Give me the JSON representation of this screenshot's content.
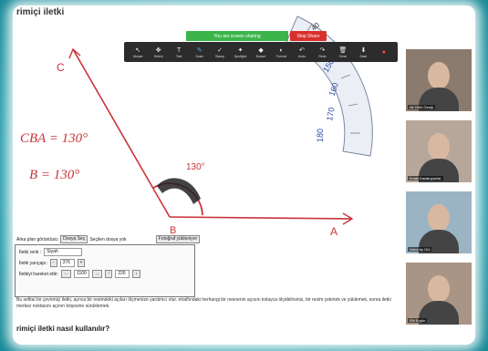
{
  "page": {
    "tab_title": "rimiçi iletki"
  },
  "whiteboard": {
    "label_c": "C",
    "label_b": "B",
    "label_a": "A",
    "eq1": "CBA = 130°",
    "eq2": "B = 130°",
    "angle_label": "130°",
    "protractor_ticks": [
      "180",
      "170",
      "160",
      "150",
      "140",
      "130",
      "50",
      "40"
    ]
  },
  "zoom": {
    "share_banner": "You are screen sharing",
    "stop_share": "Stop Share",
    "tools": [
      {
        "icon": "mouse-icon",
        "glyph": "↖",
        "label": "Mouse"
      },
      {
        "icon": "select-icon",
        "glyph": "✥",
        "label": "Select"
      },
      {
        "icon": "text-icon",
        "glyph": "T",
        "label": "Text"
      },
      {
        "icon": "draw-icon",
        "glyph": "✎",
        "label": "Draw"
      },
      {
        "icon": "stamp-icon",
        "glyph": "✓",
        "label": "Stamp"
      },
      {
        "icon": "spotlight-icon",
        "glyph": "✦",
        "label": "Spotlight"
      },
      {
        "icon": "eraser-icon",
        "glyph": "◆",
        "label": "Eraser"
      },
      {
        "icon": "format-icon",
        "glyph": "◐",
        "label": "Format"
      },
      {
        "icon": "undo-icon",
        "glyph": "↶",
        "label": "Undo"
      },
      {
        "icon": "redo-icon",
        "glyph": "↷",
        "label": "Redo"
      },
      {
        "icon": "clear-icon",
        "glyph": "🗑",
        "label": "Clear"
      },
      {
        "icon": "save-icon",
        "glyph": "⬇",
        "label": "Save"
      }
    ],
    "active_tool": 3
  },
  "participants": [
    {
      "name": "Ali Zülfü Özalp",
      "color": "#8a7b6e"
    },
    {
      "name": "Irmak Karakoyunlar",
      "color": "#b7a79b"
    },
    {
      "name": "Umut Ay Gül",
      "color": "#9ab4c4"
    },
    {
      "name": "Elif Ergün",
      "color": "#a99585"
    }
  ],
  "controls": {
    "bg_label": "Arka plan görüntüsü:",
    "file_button": "Dosya Seç",
    "file_status": "Seçilen dosya yok",
    "freeze_button": "Fotoğraf yükleniyor",
    "color_label": "İletki renk :",
    "color_value": "Siyah",
    "radius_label": "İletki yarıçapı:",
    "radius_value": "376",
    "move_label": "İletkiyi hareket ettir:",
    "move_x": "1100",
    "move_y": "226"
  },
  "text": {
    "paragraph": "Bu sefital bir çevrimiçi iletki, ayrıca bir resimdeki açıları ölçmenize yardımcı olur. etraflındaki herhangi bir nesnenin açısını kolayca ölçebilirsiniz, bir resim çekmek ve yüklemek, sonra iletki merkez noktasını açının köşesine sürüklemek.",
    "heading": "rimiçi iletki nasıl kullanılır?"
  }
}
